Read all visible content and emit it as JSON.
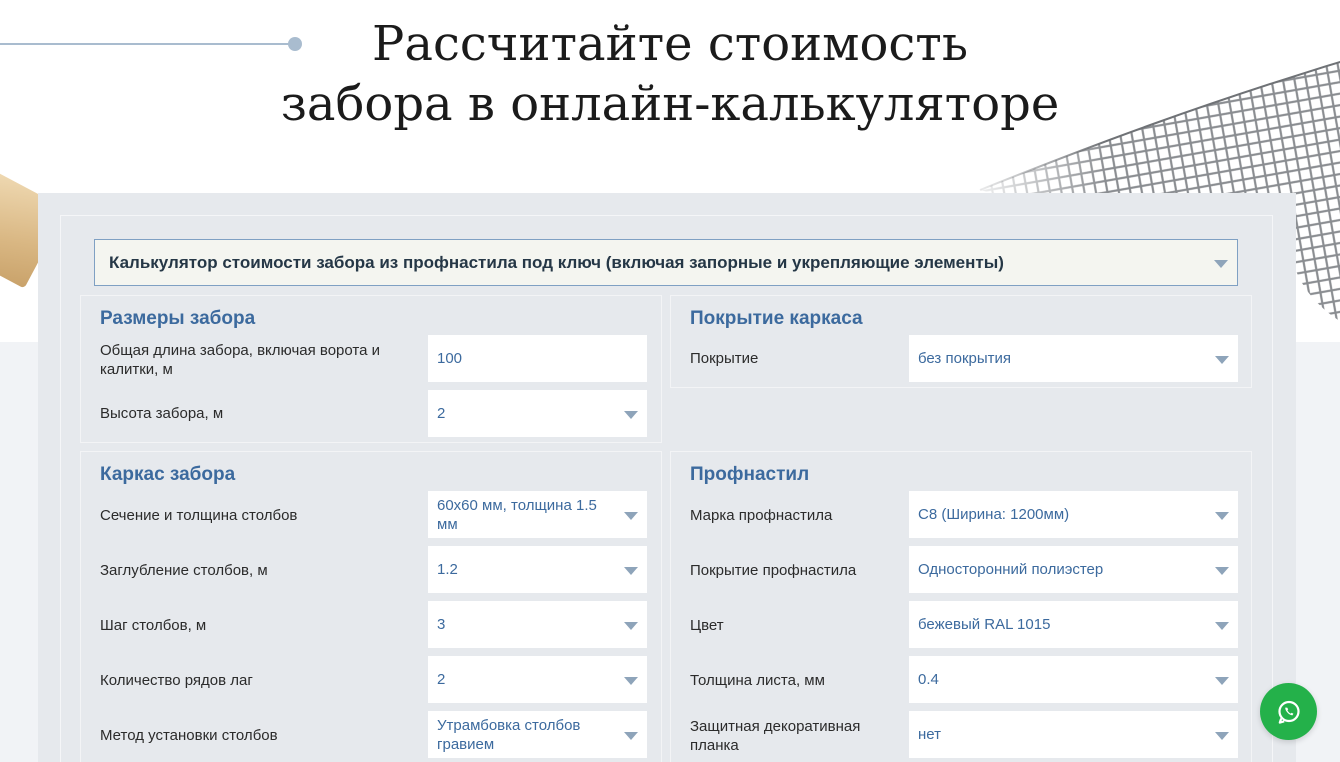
{
  "page": {
    "title_line1": "Рассчитайте стоимость",
    "title_line2": "забора в онлайн-калькуляторе"
  },
  "calculator": {
    "selected_type": "Калькулятор стоимости забора из профнастила под ключ (включая запорные и укрепляющие элементы)"
  },
  "fence_size": {
    "title": "Размеры забора",
    "rows": [
      {
        "label": "Общая длина забора, включая ворота и калитки, м",
        "value": "100"
      },
      {
        "label": "Высота забора, м",
        "value": "2"
      }
    ]
  },
  "frame_coating": {
    "title": "Покрытие каркаса",
    "rows": [
      {
        "label": "Покрытие",
        "value": "без покрытия"
      }
    ]
  },
  "frame": {
    "title": "Каркас забора",
    "rows": [
      {
        "label": "Сечение и толщина столбов",
        "value": "60х60 мм, толщина 1.5 мм"
      },
      {
        "label": "Заглубление столбов, м",
        "value": "1.2"
      },
      {
        "label": "Шаг столбов, м",
        "value": "3"
      },
      {
        "label": "Количество рядов лаг",
        "value": "2"
      },
      {
        "label": "Метод установки столбов",
        "value": "Утрамбовка столбов гравием"
      }
    ]
  },
  "profnastil": {
    "title": "Профнастил",
    "rows": [
      {
        "label": "Марка профнастила",
        "value": "С8 (Ширина: 1200мм)"
      },
      {
        "label": "Покрытие профнастила",
        "value": "Односторонний полиэстер"
      },
      {
        "label": "Цвет",
        "value": "бежевый RAL 1015"
      },
      {
        "label": "Толщина листа, мм",
        "value": "0.4"
      },
      {
        "label": "Защитная декоративная планка",
        "value": "нет"
      }
    ]
  },
  "icons": {
    "whatsapp": "whatsapp-icon",
    "dropdown": "chevron-down-icon"
  },
  "colors": {
    "accent": "#3c6a9e",
    "whatsapp": "#24b14a",
    "panel_bg": "#e6e9ed"
  }
}
